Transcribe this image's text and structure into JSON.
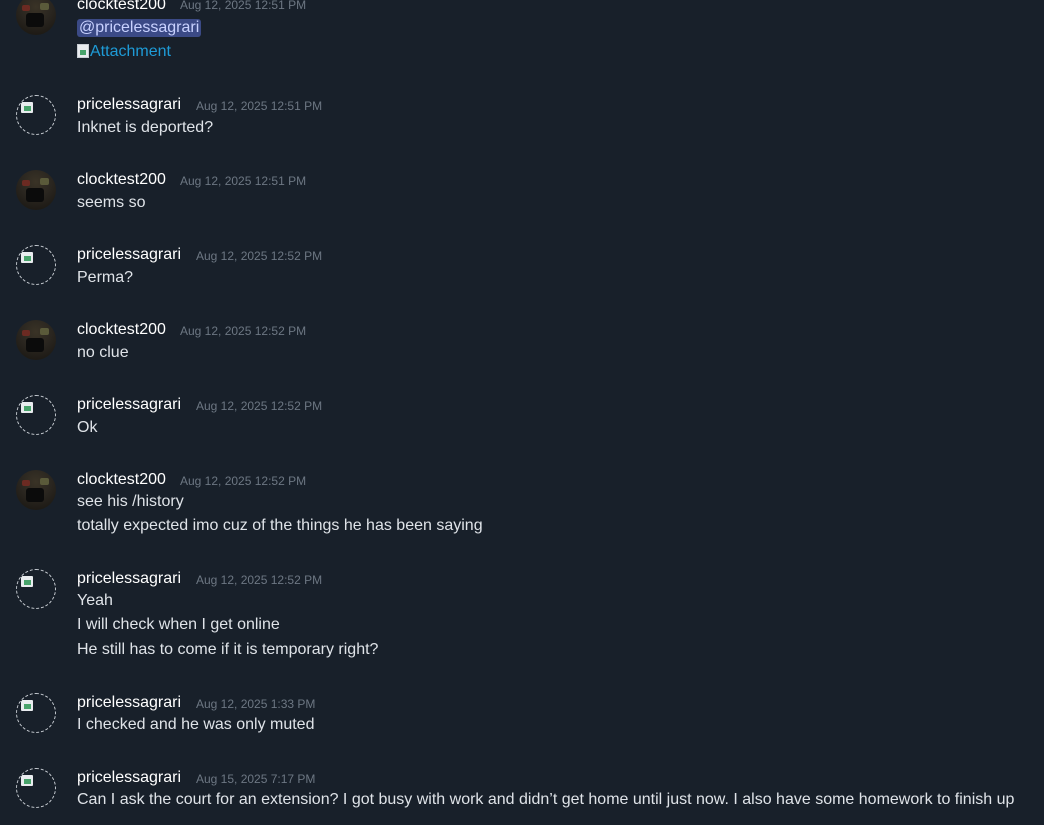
{
  "messages": [
    {
      "user": "clocktest200",
      "avatar": "clocktest200-avatar",
      "time": "Aug 12, 2025 12:51 PM",
      "mention": "@pricelessagrari",
      "attachment": "Attachment"
    },
    {
      "user": "pricelessagrari",
      "avatar": "broken-image-avatar",
      "time": "Aug 12, 2025 12:51 PM",
      "lines": [
        "Inknet is deported?"
      ]
    },
    {
      "user": "clocktest200",
      "avatar": "clocktest200-avatar",
      "time": "Aug 12, 2025 12:51 PM",
      "lines": [
        "seems so"
      ]
    },
    {
      "user": "pricelessagrari",
      "avatar": "broken-image-avatar",
      "time": "Aug 12, 2025 12:52 PM",
      "lines": [
        "Perma?"
      ]
    },
    {
      "user": "clocktest200",
      "avatar": "clocktest200-avatar",
      "time": "Aug 12, 2025 12:52 PM",
      "lines": [
        "no clue"
      ]
    },
    {
      "user": "pricelessagrari",
      "avatar": "broken-image-avatar",
      "time": "Aug 12, 2025 12:52 PM",
      "lines": [
        "Ok"
      ]
    },
    {
      "user": "clocktest200",
      "avatar": "clocktest200-avatar",
      "time": "Aug 12, 2025 12:52 PM",
      "lines": [
        "see his /history",
        "totally expected imo cuz of the things he has been saying"
      ]
    },
    {
      "user": "pricelessagrari",
      "avatar": "broken-image-avatar",
      "time": "Aug 12, 2025 12:52 PM",
      "lines": [
        "Yeah",
        "I will check when I get online",
        "He still has to come if it is temporary right?"
      ]
    },
    {
      "user": "pricelessagrari",
      "avatar": "broken-image-avatar",
      "time": "Aug 12, 2025 1:33 PM",
      "lines": [
        "I checked and he was only muted"
      ]
    },
    {
      "user": "pricelessagrari",
      "avatar": "broken-image-avatar",
      "time": "Aug 15, 2025 7:17 PM",
      "lines": [
        "Can I ask the court for an extension? I got busy with work and didn’t get home until just now. I also have some homework to finish up"
      ]
    }
  ],
  "colors": {
    "background": "#18202a",
    "username": "#ffffff",
    "timestamp": "#6d7783",
    "text": "#dfe3e8",
    "mention_bg": "#3b4a86",
    "mention_text": "#c9d2ff",
    "link": "#1e9bd7"
  }
}
